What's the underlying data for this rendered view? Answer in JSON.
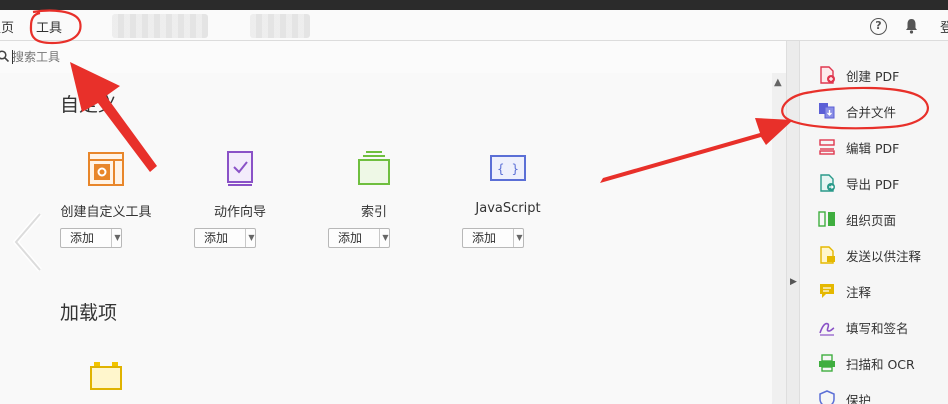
{
  "menubar": {
    "home_label": "主页",
    "tools_label": "工具"
  },
  "header": {
    "help_glyph": "?",
    "login_label": "登"
  },
  "search": {
    "placeholder": "搜索工具"
  },
  "sections": {
    "custom_title": "自定义",
    "addons_title": "加载项"
  },
  "tools": [
    {
      "label": "创建自定义工具",
      "add_label": "添加",
      "icon": "custom-tool-icon",
      "color": "#e8862a"
    },
    {
      "label": "动作向导",
      "add_label": "添加",
      "icon": "action-wizard-icon",
      "color": "#8a52c7"
    },
    {
      "label": "索引",
      "add_label": "添加",
      "icon": "index-icon",
      "color": "#6fbf3f"
    },
    {
      "label": "JavaScript",
      "add_label": "添加",
      "icon": "javascript-icon",
      "color": "#5b6fd6"
    }
  ],
  "sidebar": {
    "items": [
      {
        "label": "创建 PDF",
        "icon": "create-pdf-icon",
        "color": "#e0374f"
      },
      {
        "label": "合并文件",
        "icon": "combine-files-icon",
        "color": "#5b5fd6"
      },
      {
        "label": "编辑 PDF",
        "icon": "edit-pdf-icon",
        "color": "#e0374f"
      },
      {
        "label": "导出 PDF",
        "icon": "export-pdf-icon",
        "color": "#2a9a8a"
      },
      {
        "label": "组织页面",
        "icon": "organize-pages-icon",
        "color": "#3fae3f"
      },
      {
        "label": "发送以供注释",
        "icon": "send-for-comments-icon",
        "color": "#e5b800"
      },
      {
        "label": "注释",
        "icon": "comment-icon",
        "color": "#e5b800"
      },
      {
        "label": "填写和签名",
        "icon": "fill-sign-icon",
        "color": "#8a52c7"
      },
      {
        "label": "扫描和 OCR",
        "icon": "scan-ocr-icon",
        "color": "#3fae3f"
      },
      {
        "label": "保护",
        "icon": "protect-icon",
        "color": "#5b6fd6"
      }
    ]
  },
  "colors": {
    "annotation": "#e8302a",
    "addon_icon": "#f2c300"
  }
}
